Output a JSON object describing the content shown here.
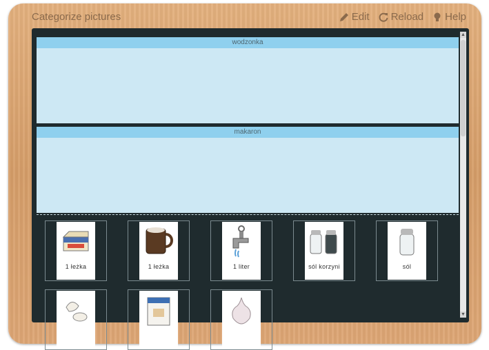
{
  "app": {
    "title": "Categorize pictures",
    "actions": {
      "edit": "Edit",
      "reload": "Reload",
      "help": "Help"
    }
  },
  "categories": [
    {
      "label": "wodzonka"
    },
    {
      "label": "makaron"
    }
  ],
  "cards": [
    {
      "label": "1 łeżka",
      "icon": "butter-icon"
    },
    {
      "label": "1 łeżka",
      "icon": "mug-icon"
    },
    {
      "label": "1 liter",
      "icon": "water-tap-icon"
    },
    {
      "label": "sól korzyni",
      "icon": "salt-pepper-icon"
    },
    {
      "label": "sól",
      "icon": "salt-shaker-icon"
    },
    {
      "label": "",
      "icon": "eggs-icon"
    },
    {
      "label": "",
      "icon": "flour-bag-icon"
    },
    {
      "label": "",
      "icon": "garlic-icon"
    }
  ],
  "colors": {
    "frame": "#d9a36f",
    "board": "#1f2b2e",
    "category_bg": "#cde8f4",
    "category_header": "#8fd0ee"
  }
}
